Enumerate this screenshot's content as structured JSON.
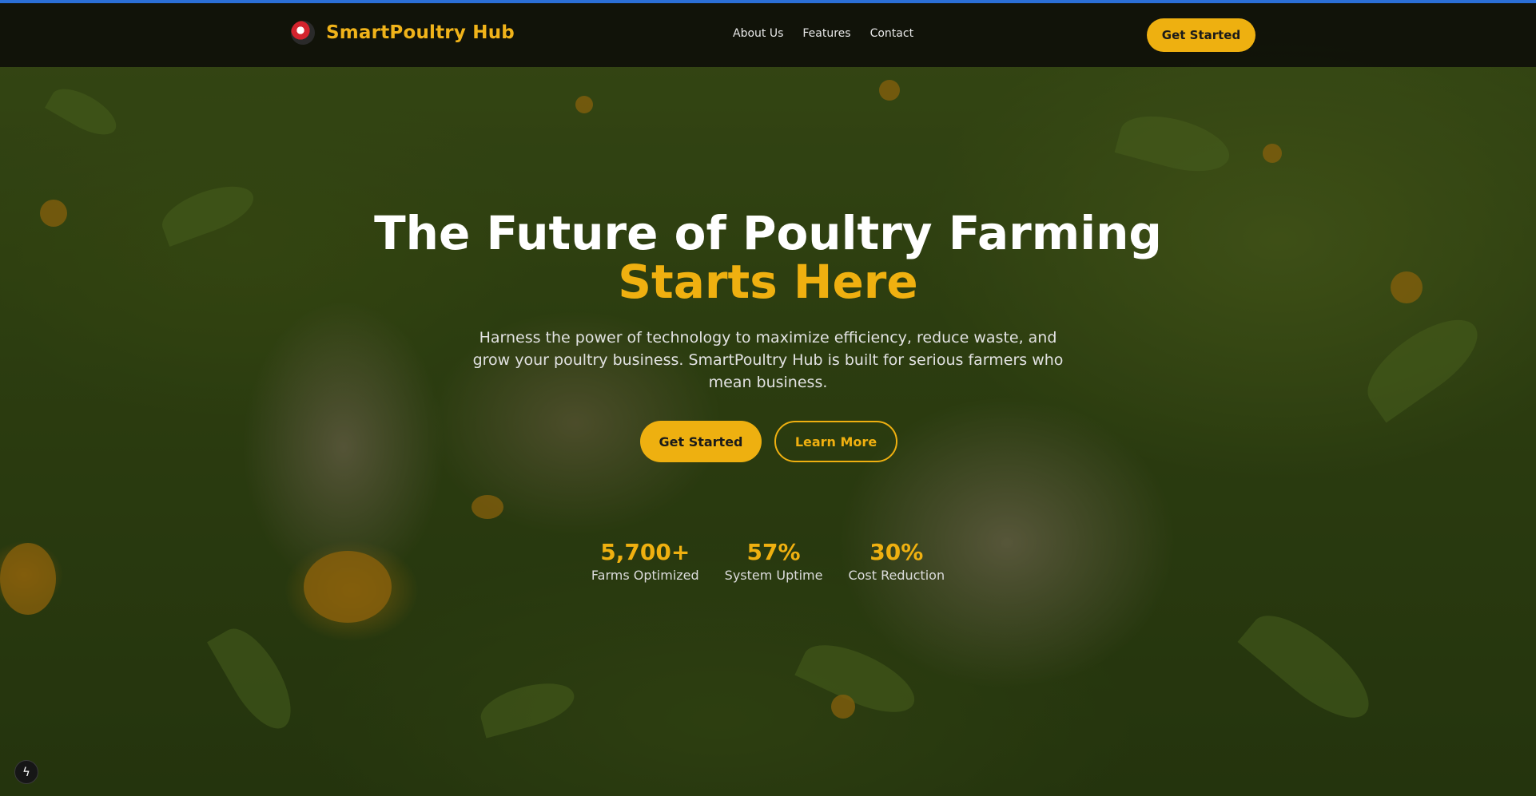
{
  "header": {
    "brand_name": "SmartPoultry Hub",
    "logo_icon": "chicken-logo-icon",
    "nav": [
      "About Us",
      "Features",
      "Contact"
    ],
    "cta_label": "Get Started"
  },
  "hero": {
    "title": "The Future of Poultry Farming",
    "title_accent": "Starts Here",
    "subtitle": "Harness the power of technology to maximize efficiency, reduce waste, and grow your poultry business. SmartPoultry Hub is built for serious farmers who mean business.",
    "primary_button": "Get Started",
    "secondary_button": "Learn More"
  },
  "stats": [
    {
      "value": "5,700+",
      "label": "Farms Optimized"
    },
    {
      "value": "57%",
      "label": "System Uptime"
    },
    {
      "value": "30%",
      "label": "Cost Reduction"
    }
  ],
  "corner_badge": {
    "icon": "lightning-icon",
    "glyph": "ϟ"
  },
  "colors": {
    "accent": "#efb010",
    "header_bg": "#0c0c08",
    "top_strip": "#2b6fd6"
  }
}
